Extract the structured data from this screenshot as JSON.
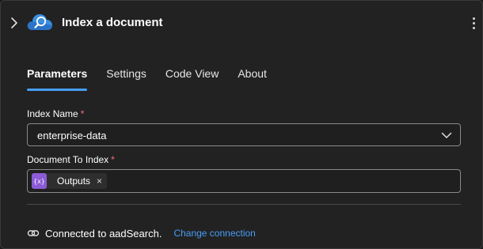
{
  "header": {
    "title": "Index a document",
    "expand_icon": "chevron-right-icon",
    "service_icon": "azure-search-cloud-icon",
    "more_icon": "more-vertical-icon"
  },
  "tabs": [
    {
      "label": "Parameters",
      "active": true
    },
    {
      "label": "Settings",
      "active": false
    },
    {
      "label": "Code View",
      "active": false
    },
    {
      "label": "About",
      "active": false
    }
  ],
  "form": {
    "index_name": {
      "label": "Index Name",
      "required_mark": "*",
      "value": "enterprise-data"
    },
    "document_to_index": {
      "label": "Document To Index",
      "required_mark": "*",
      "token": {
        "icon_text": "{x}",
        "label": "Outputs",
        "remove_glyph": "×"
      }
    }
  },
  "connection": {
    "text": "Connected to aadSearch.",
    "change_label": "Change connection"
  },
  "colors": {
    "accent": "#479ef5",
    "required": "#f1707b",
    "token_icon": "#8c5bd6",
    "background": "#222222"
  }
}
